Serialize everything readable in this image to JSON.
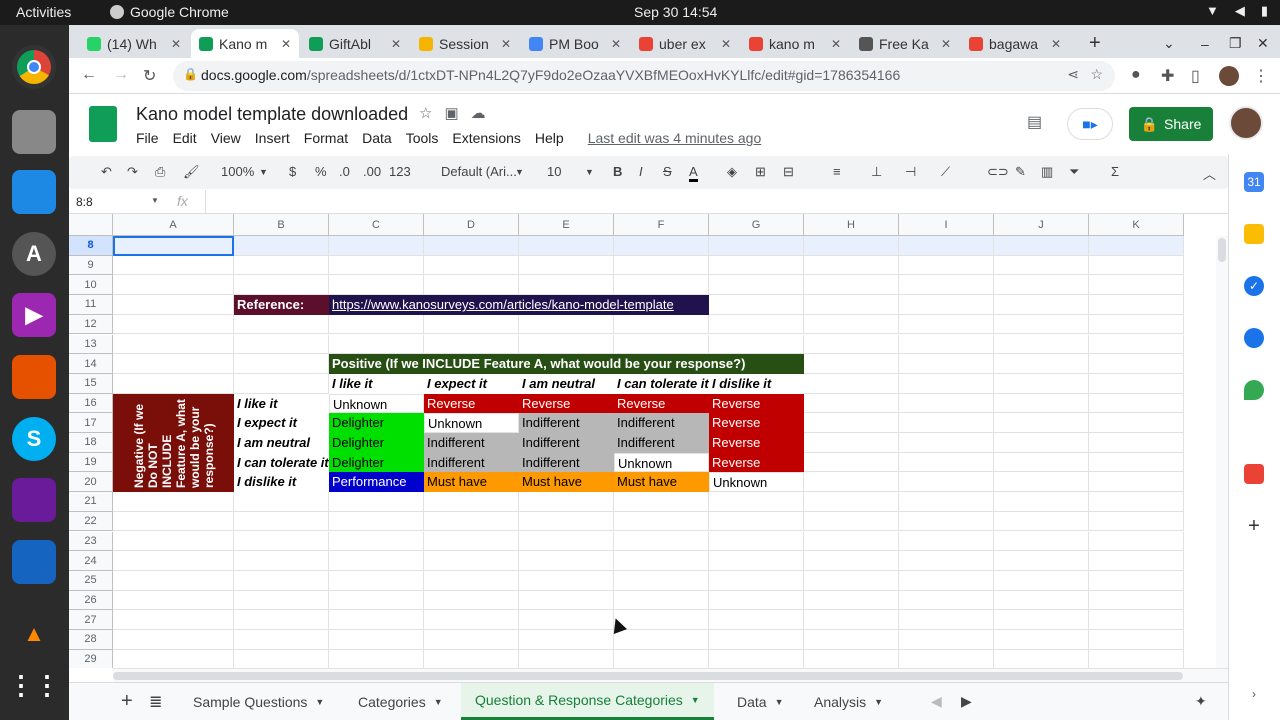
{
  "os": {
    "activities": "Activities",
    "app_name": "Google Chrome",
    "clock": "Sep 30  14:54"
  },
  "browser": {
    "tabs": [
      {
        "label": "(14) Wh",
        "fav": "#25d366"
      },
      {
        "label": "Kano m",
        "fav": "#0f9d58"
      },
      {
        "label": "GiftAbl",
        "fav": "#0f9d58"
      },
      {
        "label": "Session",
        "fav": "#f4b400"
      },
      {
        "label": "PM Boo",
        "fav": "#4285f4"
      },
      {
        "label": "uber ex",
        "fav": "#ea4335"
      },
      {
        "label": "kano m",
        "fav": "#ea4335"
      },
      {
        "label": "Free Ka",
        "fav": "#555555"
      },
      {
        "label": "bagawa",
        "fav": "#ea4335"
      }
    ],
    "url_host": "docs.google.com",
    "url_path": "/spreadsheets/d/1ctxDT-NPn4L2Q7yF9do2eOzaaYVXBfMEOoxHvKYLlfc/edit#gid=1786354166"
  },
  "doc": {
    "title": "Kano model template downloaded",
    "menu": [
      "File",
      "Edit",
      "View",
      "Insert",
      "Format",
      "Data",
      "Tools",
      "Extensions",
      "Help"
    ],
    "last_edit": "Last edit was 4 minutes ago",
    "share": "Share"
  },
  "toolbar": {
    "zoom": "100%",
    "currency": "$",
    "percent": "%",
    "dec_dec": ".0",
    "dec_inc": ".00",
    "format": "123",
    "font": "Default (Ari...",
    "size": "10",
    "bold": "B",
    "italic": "I",
    "strike": "S",
    "text_color": "A"
  },
  "formula": {
    "namebox": "8:8",
    "fx": "fx"
  },
  "grid": {
    "columns": [
      "A",
      "B",
      "C",
      "D",
      "E",
      "F",
      "G",
      "H",
      "I",
      "J",
      "K"
    ],
    "rows": [
      "8",
      "9",
      "10",
      "11",
      "12",
      "13",
      "14",
      "15",
      "16",
      "17",
      "18",
      "19",
      "20",
      "21",
      "22",
      "23",
      "24",
      "25",
      "26",
      "27",
      "28",
      "29"
    ],
    "reference_label": "Reference:",
    "reference_link": "https://www.kanosurveys.com/articles/kano-model-template",
    "positive_header": "Positive (If we INCLUDE Feature A, what would be your response?)",
    "negative_header": "Negative (If we Do NOT INCLUDE Feature A, what would be your response?)",
    "col_headers": [
      "I like it",
      "I expect it",
      "I am neutral",
      "I can tolerate it",
      "I dislike it"
    ],
    "row_headers": [
      "I like it",
      "I expect it",
      "I am neutral",
      "I can tolerate it",
      "I dislike it"
    ],
    "matrix": [
      [
        "Unknown",
        "Reverse",
        "Reverse",
        "Reverse",
        "Reverse"
      ],
      [
        "Delighter",
        "Unknown",
        "Indifferent",
        "Indifferent",
        "Reverse"
      ],
      [
        "Delighter",
        "Indifferent",
        "Indifferent",
        "Indifferent",
        "Reverse"
      ],
      [
        "Delighter",
        "Indifferent",
        "Indifferent",
        "Unknown",
        "Reverse"
      ],
      [
        "Performance",
        "Must have",
        "Must have",
        "Must have",
        "Unknown"
      ]
    ],
    "category_colors": {
      "Unknown": "#ffffff",
      "Reverse": "#c00000",
      "Delighter": "#00e000",
      "Indifferent": "#b7b7b7",
      "Performance": "#0000cc",
      "Must have": "#ff9900"
    }
  },
  "sheet_tabs": [
    "Sample Questions",
    "Categories",
    "Question & Response Categories",
    "Data",
    "Analysis"
  ],
  "active_sheet": "Question & Response Categories"
}
